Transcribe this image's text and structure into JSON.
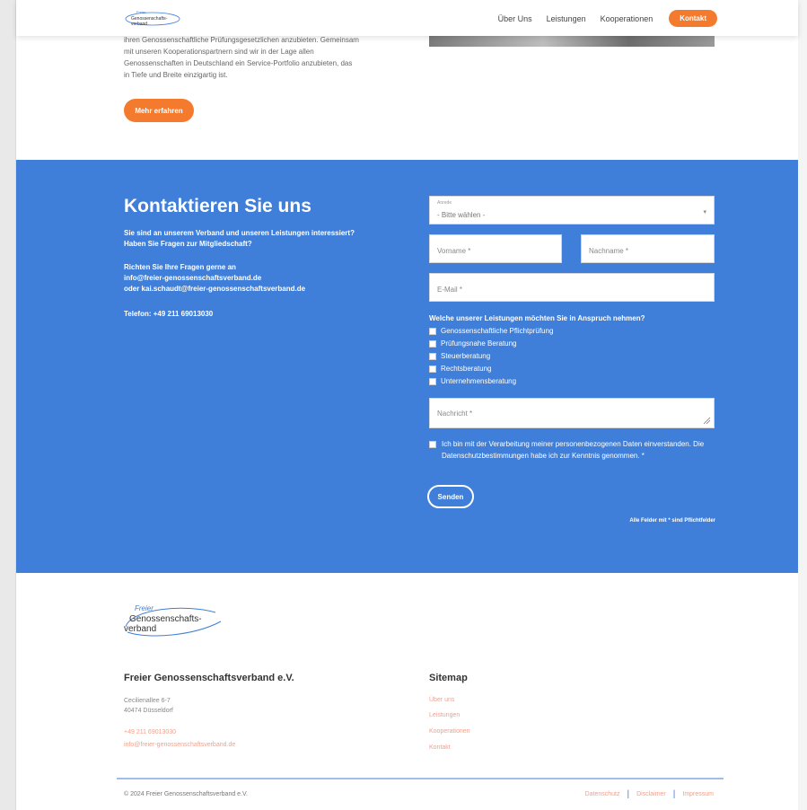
{
  "header": {
    "logo_text": "Freier Genossenschaftsverband",
    "nav": [
      "Über Uns",
      "Leistungen",
      "Kooperationen"
    ],
    "nav_button": "Kontakt"
  },
  "intro": {
    "lines": [
      "ihren Genossenschaftliche Prüfungsgesetzlichen anzubieten. Gemeinsam",
      "mit unseren Kooperationspartnern sind wir in der Lage allen",
      "Genossenschaften in Deutschland ein Service-Portfolio anzubieten, das",
      "in Tiefe und Breite einzigartig ist."
    ],
    "button": "Mehr erfahren"
  },
  "contact": {
    "title": "Kontaktieren Sie uns",
    "p1": [
      "Sie sind an unserem Verband und unseren Leistungen interessiert?",
      "Haben Sie Fragen zur Mitgliedschaft?"
    ],
    "p2": [
      "Richten Sie Ihre Fragen gerne an",
      "info@freier-genossenschaftsverband.de",
      "oder kai.schaudt@freier-genossenschaftsverband.de"
    ],
    "phone": "Telefon: +49 211 69013030",
    "form": {
      "salutation_label": "Anrede",
      "salutation_value": "- Bitte wählen -",
      "firstname": "Vorname *",
      "lastname": "Nachname *",
      "email": "E-Mail *",
      "services_question": "Welche unserer Leistungen möchten Sie in Anspruch nehmen?",
      "services": [
        "Genossenschaftliche Pflichtprüfung",
        "Prüfungsnahe Beratung",
        "Steuerberatung",
        "Rechtsberatung",
        "Unternehmensberatung"
      ],
      "message": "Nachricht *",
      "consent": "Ich bin mit der Verarbeitung meiner personenbezogenen Daten einverstanden. Die Datenschutzbestimmungen habe ich zur Kenntnis genommen. *",
      "send": "Senden",
      "required_note": "Alle Felder mit * sind Pflichtfelder"
    }
  },
  "footer": {
    "logo_lines": [
      "Freier",
      "Genossenschafts-",
      "verband"
    ],
    "company_title": "Freier Genossenschaftsverband e.V.",
    "address": [
      "Cecilienallee 6-7",
      "40474 Düsseldorf"
    ],
    "phone": "+49 211 69013030",
    "email": "info@freier-genossenschaftsverband.de",
    "sitemap_title": "Sitemap",
    "sitemap": [
      "Über uns",
      "Leistungen",
      "Kooperationen",
      "Kontakt"
    ],
    "copyright": "© 2024 Freier Genossenschaftsverband e.V.",
    "legal": [
      "Datenschutz",
      "Disclaimer",
      "Impressum"
    ]
  },
  "colors": {
    "accent": "#f47b2e",
    "contact_bg": "#3f7fd9",
    "link": "#f4a08a"
  }
}
